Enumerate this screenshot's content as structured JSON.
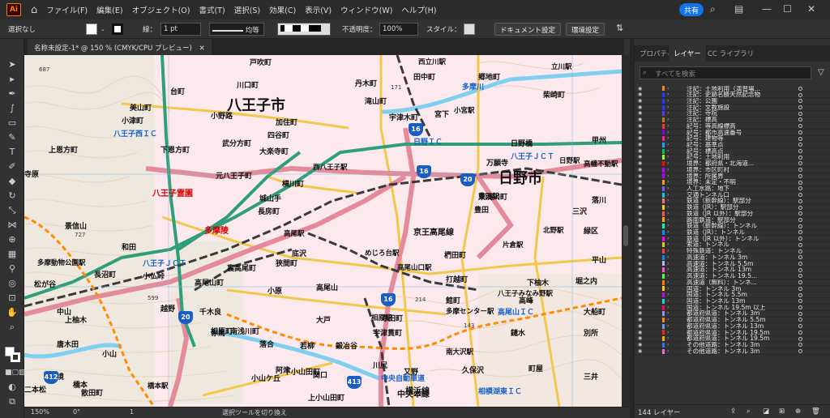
{
  "app": {
    "logo": "Ai",
    "share": "共有"
  },
  "menu": [
    "ファイル(F)",
    "編集(E)",
    "オブジェクト(O)",
    "書式(T)",
    "選択(S)",
    "効果(C)",
    "表示(V)",
    "ウィンドウ(W)",
    "ヘルプ(H)"
  ],
  "control": {
    "selection": "選択なし",
    "stroke_label": "線：",
    "stroke_value": "1 pt",
    "profile": "均等",
    "opacity_label": "不透明度：",
    "opacity": "100%",
    "style_label": "スタイル：",
    "doc_settings": "ドキュメント設定",
    "env_settings": "環境設定"
  },
  "document_tab": "名称未設定-1* @ 150 % (CMYK/CPU プレビュー)",
  "status": {
    "zoom": "150%",
    "rotation": "0°",
    "artboard": "1",
    "tool": "選択ツールを切り換え"
  },
  "panel": {
    "tabs": [
      "プロパティ",
      "レイヤー",
      "CC ライブラリ"
    ],
    "active": "レイヤー",
    "search_placeholder": "すべてを検索",
    "footer": "144 レイヤー"
  },
  "layers": [
    {
      "name": "注記：土地利用（演習場...",
      "color": "#ff8800"
    },
    {
      "name": "注記：史跡名勝天然記念物",
      "color": "#1e3cff"
    },
    {
      "name": "注記：公園",
      "color": "#1e3cff"
    },
    {
      "name": "注記：文教施設",
      "color": "#1e3cff"
    },
    {
      "name": "注記：寺院",
      "color": "#4f3cff"
    },
    {
      "name": "注記：標高",
      "color": "#c87800"
    },
    {
      "name": "記号：等高線標高",
      "color": "#ff3030"
    },
    {
      "name": "記号：都市高速番号",
      "color": "#7a00ff"
    },
    {
      "name": "記号：建物等",
      "color": "#ff1e96"
    },
    {
      "name": "記号：基準点",
      "color": "#00b4ff"
    },
    {
      "name": "記号：標高点",
      "color": "#00c850"
    },
    {
      "name": "記号：土地利用",
      "color": "#96ff00"
    },
    {
      "name": "境界：都府県・北海道...",
      "color": "#ff0000"
    },
    {
      "name": "境界：市区町村",
      "color": "#b400ff"
    },
    {
      "name": "境界：所属界",
      "color": "#b400ff"
    },
    {
      "name": "境界：未定・不明",
      "color": "#ff9600"
    },
    {
      "name": "人工水路：地下",
      "color": "#6464ff"
    },
    {
      "name": "交通トンネル口",
      "color": "#00c8ff"
    },
    {
      "name": "鉄道（新幹線）：駅部分",
      "color": "#ff7070"
    },
    {
      "name": "鉄道（JR）：駅部分",
      "color": "#ffcc00"
    },
    {
      "name": "鉄道（JR 以外）：駅部分",
      "color": "#ff5050"
    },
    {
      "name": "路面鉄道：駅部分",
      "color": "#ffaa00"
    },
    {
      "name": "鉄道（新幹線）：トンネル",
      "color": "#00ffaa"
    },
    {
      "name": "鉄道（JR）：トンネル",
      "color": "#0096ff"
    },
    {
      "name": "鉄道（JR 以外）：トンネル",
      "color": "#ff00ff"
    },
    {
      "name": "索道：トンネル",
      "color": "#d2d200"
    },
    {
      "name": "特殊鉄道：トンネル",
      "color": "#ff3c3c"
    },
    {
      "name": "高速道：トンネル 3m",
      "color": "#008cff"
    },
    {
      "name": "高速道：トンネル 5.5m",
      "color": "#b4b4ff"
    },
    {
      "name": "高速道：トンネル 13m",
      "color": "#ff50c8"
    },
    {
      "name": "高速道：トンネル 19.5...",
      "color": "#46ff46"
    },
    {
      "name": "高速道（無料）：トンネ...",
      "color": "#ff7800"
    },
    {
      "name": "国道：トンネル 3m",
      "color": "#ffd200"
    },
    {
      "name": "国道：トンネル 5.5m",
      "color": "#c800ff"
    },
    {
      "name": "国道：トンネル 13m",
      "color": "#00dcdc"
    },
    {
      "name": "国道：トンネル 19.5m 以上",
      "color": "#ff0064"
    },
    {
      "name": "都道府県道：トンネル 3m",
      "color": "#8c8cff"
    },
    {
      "name": "都道府県道：トンネル 5.5m",
      "color": "#ff8c00"
    },
    {
      "name": "都道府県道：トンネル 13m",
      "color": "#6496ff"
    },
    {
      "name": "都道府県道：トンネル 19.5m",
      "color": "#ff1e1e"
    },
    {
      "name": "都道府県道：トンネル 19.5m",
      "color": "#ffaa00"
    },
    {
      "name": "その他道路：トンネル 3m",
      "color": "#2878ff"
    },
    {
      "name": "その他道路：トンネル 3m",
      "color": "#ff64c8"
    }
  ],
  "map": {
    "big": [
      "八王子市",
      "日野市"
    ],
    "places": [
      "戸吹町",
      "西立川駅",
      "丹木町",
      "田中町",
      "郷地町",
      "立川駅",
      "川口町",
      "多摩川",
      "滝山町",
      "美山町",
      "小宮駅",
      "柴崎町",
      "小津町",
      "宇津木町",
      "宮下",
      "加住町",
      "八王子西ＩＣ",
      "四谷町",
      "日野ＩＣ",
      "日野橋",
      "甲州",
      "上恩方町",
      "下恩方町",
      "武分方町",
      "大楽寺町",
      "八王子ＪＣＴ",
      "日野駅",
      "万願寺",
      "高幡不動駅",
      "元八王子町",
      "西八王子駅",
      "横川町",
      "豊田駅",
      "豊田",
      "落川",
      "八王子霊園",
      "城山手",
      "長房町",
      "三沢",
      "景信山",
      "多摩陵",
      "高尾駅",
      "京王高尾線",
      "北野駅",
      "多摩動物公園駅",
      "底沢",
      "めじろ台駅",
      "片倉駅",
      "平山",
      "和田",
      "八王子ＪＣＴ",
      "裏高尾町",
      "狭間町",
      "椚田町",
      "長沼町",
      "小仏峠",
      "高尾山町",
      "高尾山口駅",
      "打越町",
      "下柚木",
      "堀之内",
      "松が谷",
      "小原",
      "高尾山",
      "館町",
      "八王子みなみ野駅",
      "中山",
      "越野",
      "千木良",
      "高尾山ＩＣ",
      "大船町",
      "上柚木",
      "多摩センター駅",
      "赤馬",
      "南浅川町",
      "大戸",
      "寺田町",
      "宇津貫町",
      "鑓水",
      "別所",
      "唐木田",
      "落合",
      "若柳",
      "鍛冶谷",
      "相原町",
      "相原駅",
      "小山",
      "南大沢駅",
      "阿津",
      "川尻",
      "久保沢",
      "町屋",
      "境",
      "小山ケ丘",
      "下小山田町",
      "関口",
      "又野",
      "三井",
      "二本松",
      "橋本",
      "橋本駅",
      "上小山田町",
      "中央自動車道",
      "中央本線",
      "横浜線",
      "相模湖東ＩＣ",
      "寺原",
      "高峰",
      "緑区",
      "東浅川町",
      "散田町",
      "台町",
      "小野路"
    ],
    "numbers": [
      "687",
      "727",
      "599",
      "214",
      "143",
      "171"
    ],
    "routes": [
      "16",
      "16",
      "20",
      "20",
      "16",
      "413",
      "412"
    ]
  }
}
